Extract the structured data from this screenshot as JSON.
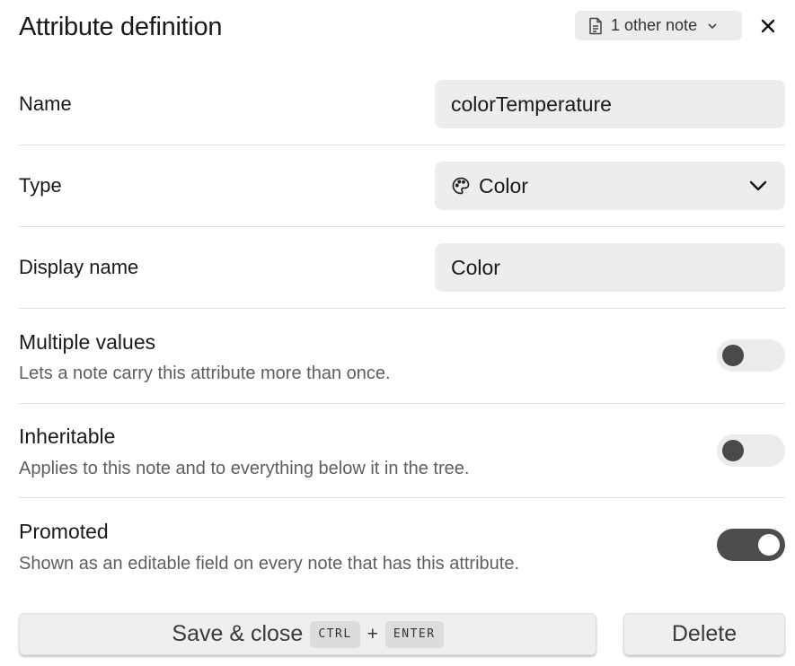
{
  "header": {
    "title": "Attribute definition",
    "other_notes_label": "1 other note"
  },
  "fields": {
    "name": {
      "label": "Name",
      "value": "colorTemperature"
    },
    "type": {
      "label": "Type",
      "value": "Color"
    },
    "display_name": {
      "label": "Display name",
      "value": "Color"
    }
  },
  "options": [
    {
      "title": "Multiple values",
      "description": "Lets a note carry this attribute more than once.",
      "enabled": false
    },
    {
      "title": "Inheritable",
      "description": "Applies to this note and to everything below it in the tree.",
      "enabled": false
    },
    {
      "title": "Promoted",
      "description": "Shown as an editable field on every note that has this attribute.",
      "enabled": true
    }
  ],
  "actions": {
    "save_label": "Save & close",
    "shortcut_key1": "CTRL",
    "shortcut_plus": "+",
    "shortcut_key2": "ENTER",
    "delete_label": "Delete"
  },
  "icons": [
    "document-icon",
    "chevron-down-icon",
    "close-icon",
    "palette-icon"
  ]
}
